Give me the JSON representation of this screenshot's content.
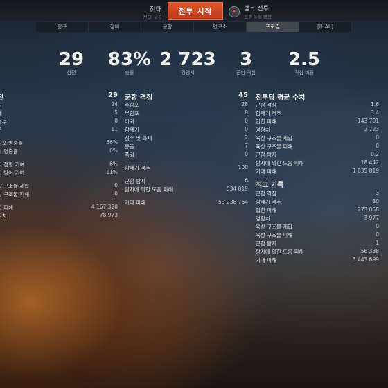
{
  "topbar": {
    "mode_title": "전대",
    "mode_sub": "전대 구성",
    "battle_button": "전투 시작",
    "ranked_title": "랭크 전투",
    "ranked_sub": "전투 유형 변경"
  },
  "tabs": [
    {
      "label": "항구"
    },
    {
      "label": "장비"
    },
    {
      "label": "군함"
    },
    {
      "label": "연구소"
    },
    {
      "label": "프로필"
    },
    {
      "label": "[IHAL]"
    }
  ],
  "active_tab_index": 4,
  "summary": [
    {
      "value": "29",
      "label": "참전"
    },
    {
      "value": "83%",
      "label": "승률"
    },
    {
      "value": "2 723",
      "label": "경험치"
    },
    {
      "value": "3",
      "label": "군함 격침"
    },
    {
      "value": "2.5",
      "label": "격침 비율"
    }
  ],
  "col1": {
    "title": "전",
    "total": "29",
    "rows": [
      {
        "k": "리",
        "v": "24"
      },
      {
        "k": "배",
        "v": "5"
      },
      {
        "k": "승부",
        "v": "0"
      },
      {
        "k": "존",
        "v": "11"
      },
      {
        "gap": true
      },
      {
        "k": "함포 명중률",
        "v": "56%"
      },
      {
        "k": "뢰 명중률",
        "v": "0%"
      },
      {
        "gap": true
      },
      {
        "k": "지 점령 기여",
        "v": "6%"
      },
      {
        "k": "지 방어 기여",
        "v": "11%"
      },
      {
        "gap": true
      },
      {
        "k": "상 구조물 제압",
        "v": "0"
      },
      {
        "k": "상 구조물 피해",
        "v": "0"
      },
      {
        "gap": true
      },
      {
        "k": "힌 피해",
        "v": "4 167 320"
      },
      {
        "k": "험치",
        "v": "78 973"
      }
    ]
  },
  "col2": {
    "title": "군함 격침",
    "total": "45",
    "rows": [
      {
        "k": "주함포",
        "v": "28"
      },
      {
        "k": "부함포",
        "v": "8"
      },
      {
        "k": "어뢰",
        "v": "0"
      },
      {
        "k": "함재기",
        "v": "0"
      },
      {
        "k": "침수 및 화재",
        "v": "2"
      },
      {
        "k": "충돌",
        "v": "7"
      },
      {
        "k": "폭뢰",
        "v": "0"
      },
      {
        "gap": true
      },
      {
        "k": "함재기 격추",
        "v": "100"
      },
      {
        "gap": true
      },
      {
        "k": "군함 탐지",
        "v": "6"
      },
      {
        "k": "탐지에 의한 도움 피해",
        "v": "534 819"
      },
      {
        "gap": true
      },
      {
        "k": "기대 피해",
        "v": "53 238 764"
      }
    ]
  },
  "col3": {
    "title": "전투당 평균 수치",
    "rows": [
      {
        "k": "군함 격침",
        "v": "1.6"
      },
      {
        "k": "함재기 격추",
        "v": "3.4"
      },
      {
        "k": "입힌 피해",
        "v": "143 701"
      },
      {
        "k": "경험치",
        "v": "2 723"
      },
      {
        "k": "육상 구조물 제압",
        "v": "0"
      },
      {
        "k": "육상 구조물 피해",
        "v": "0"
      },
      {
        "k": "군함 탐지",
        "v": "0.2"
      },
      {
        "k": "탐지에 의한 도움 피해",
        "v": "18 442"
      },
      {
        "k": "기대 피해",
        "v": "1 835 819"
      }
    ],
    "records_title": "최고 기록",
    "records": [
      {
        "k": "군함 격침",
        "v": "3"
      },
      {
        "k": "함재기 격추",
        "v": "30"
      },
      {
        "k": "입힌 피해",
        "v": "273 058"
      },
      {
        "k": "경험치",
        "v": "3 977"
      },
      {
        "k": "육상 구조물 제압",
        "v": "0"
      },
      {
        "k": "육상 구조물 피해",
        "v": "0"
      },
      {
        "k": "군함 탐지",
        "v": "1"
      },
      {
        "k": "탐지에 의한 도움 피해",
        "v": "56 338"
      },
      {
        "k": "기대 피해",
        "v": "3 443 699"
      }
    ]
  }
}
